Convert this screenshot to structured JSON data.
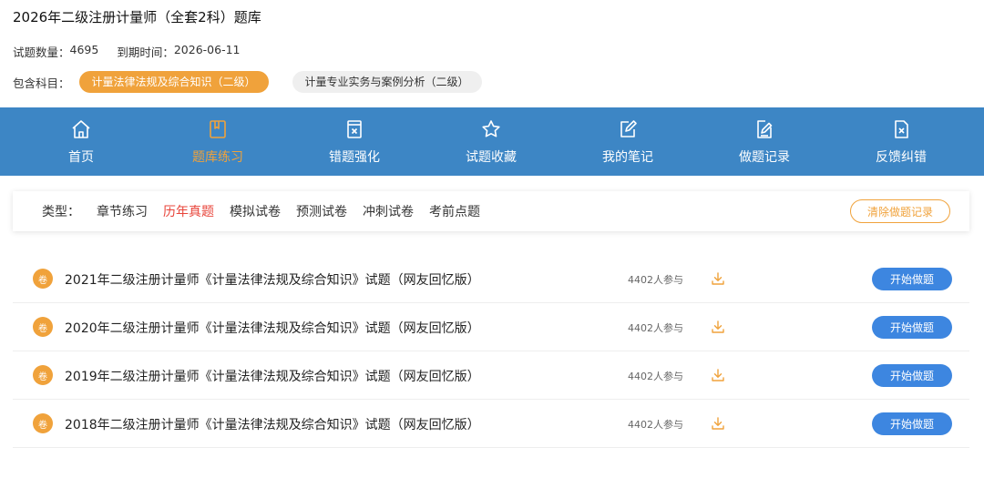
{
  "header": {
    "title": "2026年二级注册计量师（全套2科）题库",
    "question_count_label": "试题数量：",
    "question_count": "4695",
    "expiry_label": "到期时间：",
    "expiry_date": "2026-06-11",
    "subjects_label": "包含科目：",
    "subjects": [
      {
        "label": "计量法律法规及综合知识（二级）",
        "active": true
      },
      {
        "label": "计量专业实务与案例分析（二级）",
        "active": false
      }
    ]
  },
  "nav": {
    "items": [
      {
        "label": "首页",
        "icon": "home-icon",
        "active": false
      },
      {
        "label": "题库练习",
        "icon": "book-icon",
        "active": true
      },
      {
        "label": "错题强化",
        "icon": "error-sheet-icon",
        "active": false
      },
      {
        "label": "试题收藏",
        "icon": "star-icon",
        "active": false
      },
      {
        "label": "我的笔记",
        "icon": "note-edit-icon",
        "active": false
      },
      {
        "label": "做题记录",
        "icon": "record-icon",
        "active": false
      },
      {
        "label": "反馈纠错",
        "icon": "feedback-icon",
        "active": false
      }
    ]
  },
  "filter": {
    "type_label": "类型：",
    "tabs": [
      {
        "label": "章节练习",
        "active": false
      },
      {
        "label": "历年真题",
        "active": true
      },
      {
        "label": "模拟试卷",
        "active": false
      },
      {
        "label": "预测试卷",
        "active": false
      },
      {
        "label": "冲刺试卷",
        "active": false
      },
      {
        "label": "考前点题",
        "active": false
      }
    ],
    "clear_label": "清除做题记录"
  },
  "papers": [
    {
      "badge": "卷",
      "title": "2021年二级注册计量师《计量法律法规及综合知识》试题（网友回忆版）",
      "participants": "4402人参与",
      "action": "开始做题"
    },
    {
      "badge": "卷",
      "title": "2020年二级注册计量师《计量法律法规及综合知识》试题（网友回忆版）",
      "participants": "4402人参与",
      "action": "开始做题"
    },
    {
      "badge": "卷",
      "title": "2019年二级注册计量师《计量法律法规及综合知识》试题（网友回忆版）",
      "participants": "4402人参与",
      "action": "开始做题"
    },
    {
      "badge": "卷",
      "title": "2018年二级注册计量师《计量法律法规及综合知识》试题（网友回忆版）",
      "participants": "4402人参与",
      "action": "开始做题"
    }
  ],
  "colors": {
    "nav_bg": "#3d86c5",
    "accent_orange": "#f0a23b",
    "active_red": "#e8443a",
    "button_blue": "#3d86e0"
  }
}
